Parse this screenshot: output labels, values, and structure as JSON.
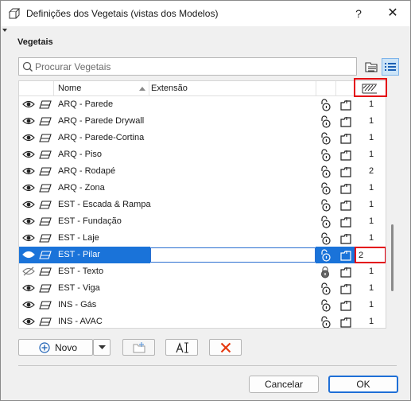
{
  "window": {
    "title": "Definições dos Vegetais (vistas dos Modelos)",
    "help": "?",
    "close": "✕"
  },
  "section": {
    "label": "Vegetais"
  },
  "search": {
    "placeholder": "Procurar Vegetais"
  },
  "table": {
    "columns": {
      "name": "Nome",
      "extension": "Extensão"
    },
    "rows": [
      {
        "name": "ARQ - Parede",
        "pen": "1",
        "visible": true,
        "locked": false,
        "selected": false
      },
      {
        "name": "ARQ - Parede Drywall",
        "pen": "1",
        "visible": true,
        "locked": false,
        "selected": false
      },
      {
        "name": "ARQ - Parede-Cortina",
        "pen": "1",
        "visible": true,
        "locked": false,
        "selected": false
      },
      {
        "name": "ARQ - Piso",
        "pen": "1",
        "visible": true,
        "locked": false,
        "selected": false
      },
      {
        "name": "ARQ - Rodapé",
        "pen": "2",
        "visible": true,
        "locked": false,
        "selected": false
      },
      {
        "name": "ARQ - Zona",
        "pen": "1",
        "visible": true,
        "locked": false,
        "selected": false
      },
      {
        "name": "EST - Escada & Rampa",
        "pen": "1",
        "visible": true,
        "locked": false,
        "selected": false
      },
      {
        "name": "EST - Fundação",
        "pen": "1",
        "visible": true,
        "locked": false,
        "selected": false
      },
      {
        "name": "EST - Laje",
        "pen": "1",
        "visible": true,
        "locked": false,
        "selected": false
      },
      {
        "name": "EST - Pilar",
        "pen": "2",
        "visible": true,
        "locked": false,
        "selected": true
      },
      {
        "name": "EST - Texto",
        "pen": "1",
        "visible": false,
        "locked": true,
        "selected": false
      },
      {
        "name": "EST - Viga",
        "pen": "1",
        "visible": true,
        "locked": false,
        "selected": false
      },
      {
        "name": "INS -  Gás",
        "pen": "1",
        "visible": true,
        "locked": false,
        "selected": false
      },
      {
        "name": "INS - AVAC",
        "pen": "1",
        "visible": true,
        "locked": false,
        "selected": false
      }
    ]
  },
  "buttons": {
    "new": "Novo",
    "cancel": "Cancelar",
    "ok": "OK"
  },
  "colors": {
    "selection": "#1a73d9",
    "highlight": "#e3000f",
    "ok_border": "#1f6fd6",
    "delete_icon": "#e53a10"
  },
  "icons": [
    "app-icon",
    "search-icon",
    "folder-view-icon",
    "list-view-icon",
    "eye-icon",
    "eye-hidden-icon",
    "layer-icon",
    "lock-open-icon",
    "lock-closed-icon",
    "document-icon",
    "pen-header-icon",
    "add-icon",
    "chevron-down-icon",
    "new-folder-icon",
    "rename-icon",
    "delete-icon"
  ]
}
